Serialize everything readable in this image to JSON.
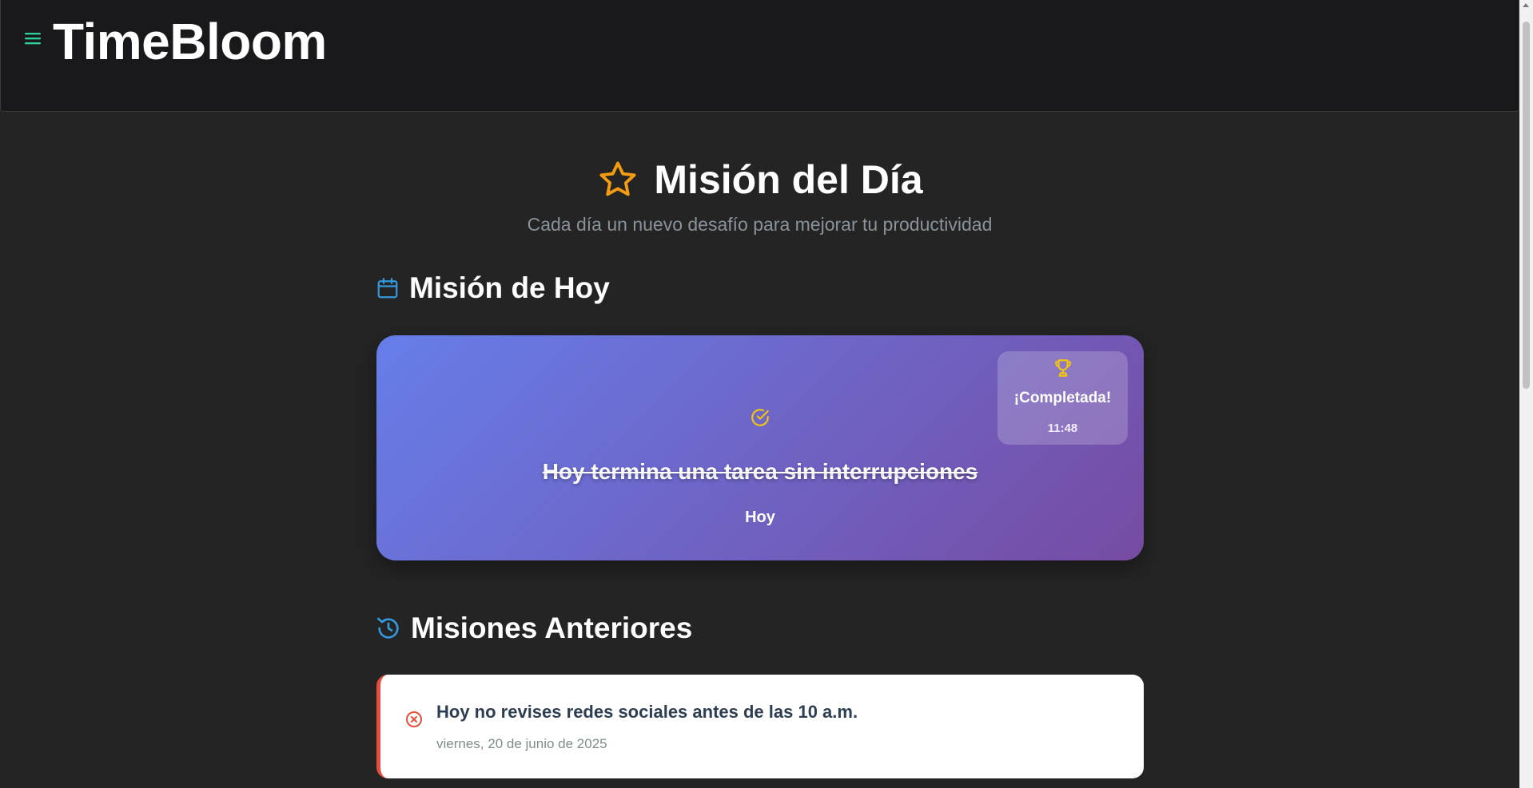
{
  "app": {
    "title": "TimeBloom",
    "menu_icon": "hamburger-menu-icon"
  },
  "hero": {
    "icon": "star-icon",
    "title": "Misión del Día",
    "subtitle": "Cada día un nuevo desafío para mejorar tu productividad"
  },
  "today": {
    "heading_icon": "calendar-icon",
    "heading": "Misión de Hoy",
    "mission": "Hoy termina una tarea sin interrupciones",
    "date_label": "Hoy",
    "status_icon": "check-circle-icon",
    "badge": {
      "icon": "trophy-icon",
      "label": "¡Completada!",
      "time": "11:48"
    }
  },
  "previous": {
    "heading_icon": "history-icon",
    "heading": "Misiones Anteriores",
    "items": [
      {
        "status_icon": "x-circle-icon",
        "text": "Hoy no revises redes sociales antes de las 10 a.m.",
        "date": "viernes, 20 de junio de 2025"
      }
    ]
  },
  "colors": {
    "background": "#242424",
    "header": "#19191b",
    "accent_green": "#2ecc9a",
    "star": "#f39c12",
    "section_icon": "#3498db",
    "card_gradient_start": "#667eea",
    "card_gradient_end": "#764ba2",
    "badge_gold": "#f1c40f",
    "failed": "#e74c3c"
  }
}
